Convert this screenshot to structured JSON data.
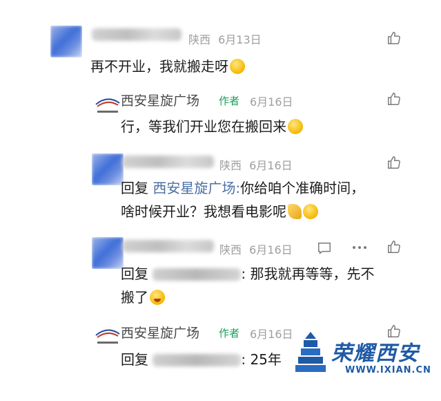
{
  "comments": [
    {
      "location": "陕西",
      "date": "6月13日",
      "text": "再不开业，我就搬走呀"
    },
    {
      "name": "西安星旋广场",
      "author_badge": "作者",
      "date": "6月16日",
      "text": "行，等我们开业您在搬回来"
    },
    {
      "location": "陕西",
      "date": "6月16日",
      "reply_prefix": "回复",
      "reply_to": "西安星旋广场:",
      "text_line1": "你给咱个准确时间，",
      "text_line2": "啥时候开业？我想看电影呢"
    },
    {
      "location": "陕西",
      "date": "6月16日",
      "reply_prefix": "回复",
      "text_line1": ": 那我就再等等，先不",
      "text_line2": "搬了"
    },
    {
      "name": "西安星旋广场",
      "author_badge": "作者",
      "date": "6月16日",
      "reply_prefix": "回复",
      "text_line1": ": 25年"
    }
  ],
  "watermark": {
    "text": "荣耀西安",
    "url": "WWW.IXIAN.CN"
  },
  "icons": {
    "like": "thumbs-up-icon",
    "reply": "comment-icon",
    "more": "more-dots-icon"
  }
}
